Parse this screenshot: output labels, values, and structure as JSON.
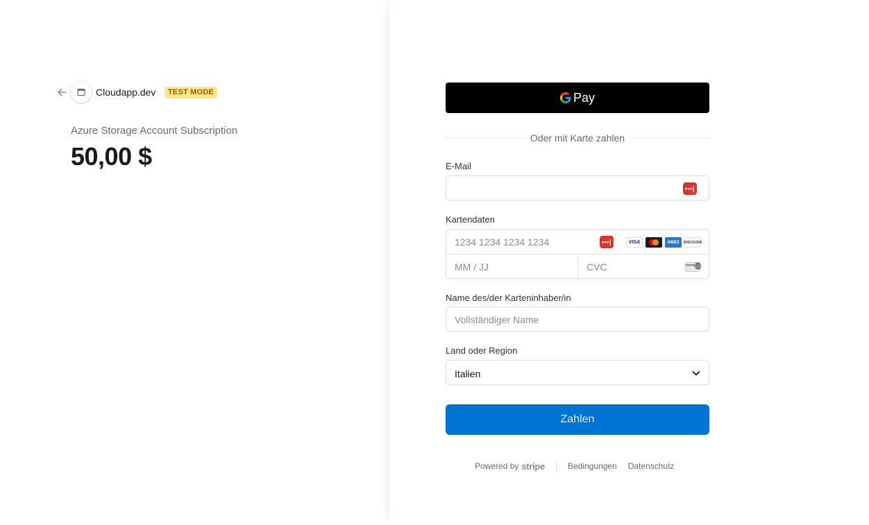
{
  "merchant": {
    "name": "Cloudapp.dev",
    "badge": "TEST MODE"
  },
  "product": {
    "name": "Azure Storage Account Subscription",
    "price": "50,00 $"
  },
  "gpay": {
    "label": "Pay"
  },
  "divider_text": "Oder mit Karte zahlen",
  "email": {
    "label": "E-Mail",
    "value": ""
  },
  "card": {
    "label": "Kartendaten",
    "number_placeholder": "1234 1234 1234 1234",
    "expiry_placeholder": "MM / JJ",
    "cvc_placeholder": "CVC",
    "brands": [
      "VISA",
      "MC",
      "AMEX",
      "DISCOVER"
    ]
  },
  "cardholder": {
    "label": "Name des/der Karteninhaber/in",
    "placeholder": "Vollständiger Name"
  },
  "country": {
    "label": "Land oder Region",
    "selected": "Italien"
  },
  "pay_button": "Zahlen",
  "footer": {
    "powered_by": "Powered by",
    "stripe": "stripe",
    "terms": "Bedingungen",
    "privacy": "Datenschutz"
  },
  "colors": {
    "accent": "#0074d4",
    "badge_bg": "#fde68a",
    "badge_text": "#a15c07",
    "password_icon": "#d5362e"
  }
}
